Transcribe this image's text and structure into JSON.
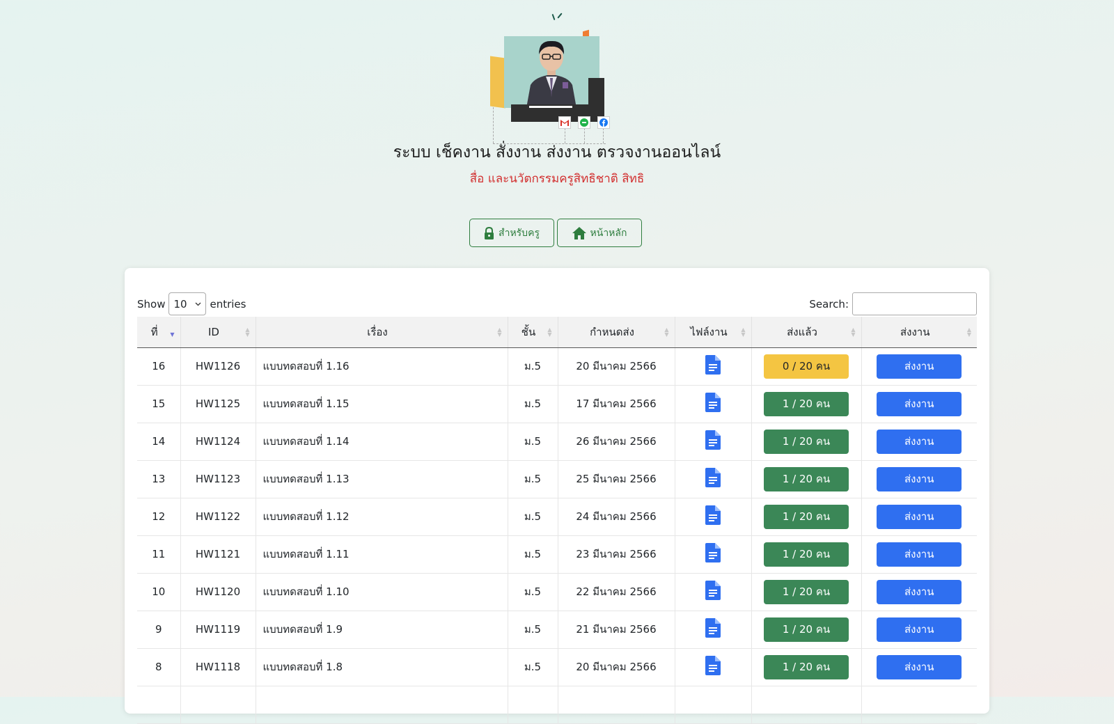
{
  "header": {
    "title": "ระบบ เช็คงาน สั่งงาน ส่งงาน ตรวจงานออนไลน์",
    "subtitle": "สื่อ และนวัตกรรมครูสิทธิชาติ สิทธิ",
    "social_icons": [
      "gmail-icon",
      "line-icon",
      "facebook-icon"
    ]
  },
  "nav": {
    "teacher_label": "สำหรับครู",
    "home_label": "หน้าหลัก"
  },
  "table_controls": {
    "show_label": "Show",
    "entries_value": "10",
    "entries_label": "entries",
    "search_label": "Search:",
    "search_value": ""
  },
  "columns": [
    "ที่",
    "ID",
    "เรื่อง",
    "ชั้น",
    "กำหนดส่ง",
    "ไฟล์งาน",
    "ส่งแล้ว",
    "ส่งงาน"
  ],
  "rows": [
    {
      "no": "16",
      "id": "HW1126",
      "subject": "แบบทดสอบที่ 1.16",
      "level": "ม.5",
      "due": "20 มีนาคม 2566",
      "submitted": "0 / 20 คน",
      "status": "warn",
      "action": "ส่งงาน"
    },
    {
      "no": "15",
      "id": "HW1125",
      "subject": "แบบทดสอบที่ 1.15",
      "level": "ม.5",
      "due": "17 มีนาคม 2566",
      "submitted": "1 / 20 คน",
      "status": "ok",
      "action": "ส่งงาน"
    },
    {
      "no": "14",
      "id": "HW1124",
      "subject": "แบบทดสอบที่ 1.14",
      "level": "ม.5",
      "due": "26 มีนาคม 2566",
      "submitted": "1 / 20 คน",
      "status": "ok",
      "action": "ส่งงาน"
    },
    {
      "no": "13",
      "id": "HW1123",
      "subject": "แบบทดสอบที่ 1.13",
      "level": "ม.5",
      "due": "25 มีนาคม 2566",
      "submitted": "1 / 20 คน",
      "status": "ok",
      "action": "ส่งงาน"
    },
    {
      "no": "12",
      "id": "HW1122",
      "subject": "แบบทดสอบที่ 1.12",
      "level": "ม.5",
      "due": "24 มีนาคม 2566",
      "submitted": "1 / 20 คน",
      "status": "ok",
      "action": "ส่งงาน"
    },
    {
      "no": "11",
      "id": "HW1121",
      "subject": "แบบทดสอบที่ 1.11",
      "level": "ม.5",
      "due": "23 มีนาคม 2566",
      "submitted": "1 / 20 คน",
      "status": "ok",
      "action": "ส่งงาน"
    },
    {
      "no": "10",
      "id": "HW1120",
      "subject": "แบบทดสอบที่ 1.10",
      "level": "ม.5",
      "due": "22 มีนาคม 2566",
      "submitted": "1 / 20 คน",
      "status": "ok",
      "action": "ส่งงาน"
    },
    {
      "no": "9",
      "id": "HW1119",
      "subject": "แบบทดสอบที่ 1.9",
      "level": "ม.5",
      "due": "21 มีนาคม 2566",
      "submitted": "1 / 20 คน",
      "status": "ok",
      "action": "ส่งงาน"
    },
    {
      "no": "8",
      "id": "HW1118",
      "subject": "แบบทดสอบที่ 1.8",
      "level": "ม.5",
      "due": "20 มีนาคม 2566",
      "submitted": "1 / 20 คน",
      "status": "ok",
      "action": "ส่งงาน"
    },
    {
      "no": "",
      "id": "",
      "subject": "",
      "level": "",
      "due": "",
      "submitted": "",
      "status": "ok",
      "action": ""
    }
  ],
  "colors": {
    "accent_green": "#2e7d3e",
    "badge_pending": "#f4c542",
    "badge_submitted": "#3b8757",
    "submit_blue": "#2f6ff0",
    "file_icon": "#2f6ff0",
    "subtitle_red": "#d22f2f"
  },
  "icons": {
    "teacher": "lock-icon",
    "home": "home-icon",
    "file": "document-icon",
    "sort": "sort-icon"
  }
}
